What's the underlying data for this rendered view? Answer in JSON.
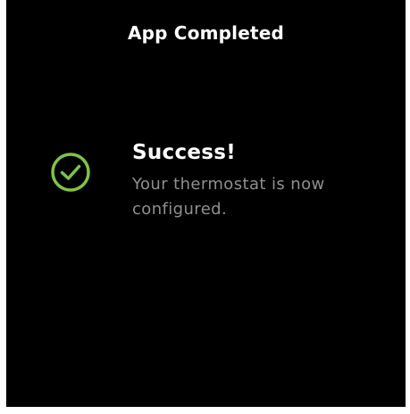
{
  "screen": {
    "title": "App Completed",
    "background_color": "#000000"
  },
  "status": {
    "icon": "check-circle-icon",
    "icon_color": "#7fc24a",
    "heading": "Success!",
    "message": "Your thermostat is now configured."
  }
}
